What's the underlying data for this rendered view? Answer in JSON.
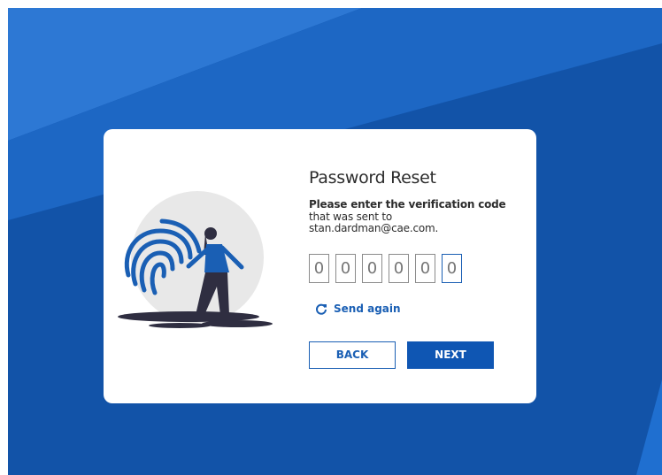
{
  "colors": {
    "accent": "#1a5fb4",
    "background": "#1253a8",
    "card": "#ffffff"
  },
  "dialog": {
    "title": "Password Reset",
    "instruction_bold": "Please enter the verification code",
    "instruction_line2": "that was sent to",
    "email": "stan.dardman@cae.com.",
    "code_digits": [
      "0",
      "0",
      "0",
      "0",
      "0",
      "0"
    ],
    "send_again_icon": "refresh-icon",
    "send_again_label": "Send again",
    "back_label": "BACK",
    "next_label": "NEXT",
    "illustration_icon": "fingerprint-icon"
  }
}
